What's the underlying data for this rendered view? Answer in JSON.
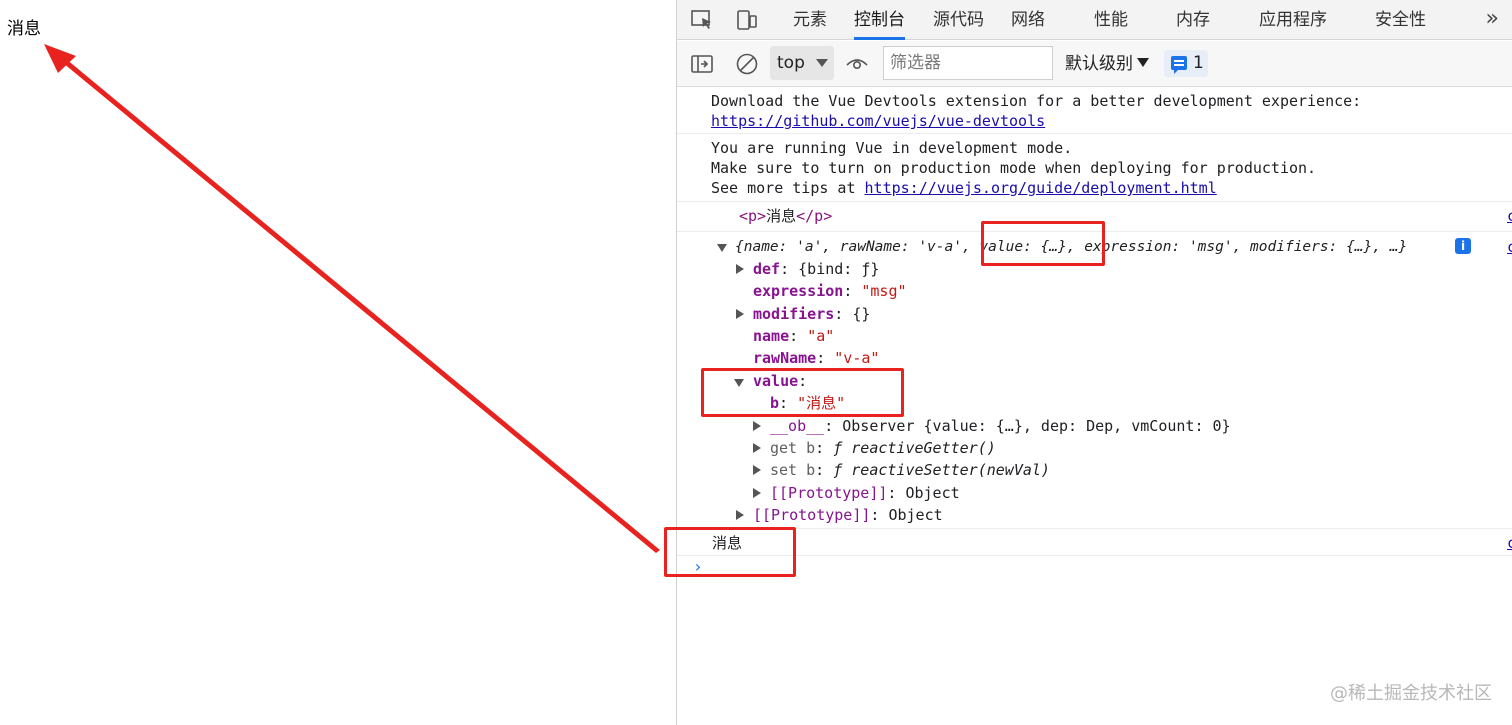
{
  "page": {
    "text": "消息"
  },
  "devtools": {
    "tabs": [
      "元素",
      "控制台",
      "源代码",
      "网络",
      "性能",
      "内存",
      "应用程序",
      "安全性"
    ],
    "active_tab": "控制台",
    "toolbar": {
      "context": "top",
      "filter_placeholder": "筛选器",
      "levels": "默认级别",
      "issues_count": "1"
    }
  },
  "console": {
    "msg1": {
      "text": "Download the Vue Devtools extension for a better development experience:",
      "link": "https://github.com/vuejs/vue-devtools"
    },
    "msg2": {
      "line1": "You are running Vue in development mode.",
      "line2": "Make sure to turn on production mode when deploying for production.",
      "line3_prefix": "See more tips at ",
      "link": "https://vuejs.org/guide/deployment.html"
    },
    "msg3": {
      "open": "<p>",
      "content": "消息",
      "close": "</p>"
    },
    "obj": {
      "summary": "{name: 'a', rawName: 'v-a', value: {…}, expression: 'msg', modifiers: {…}, …}",
      "def_key": "def",
      "def_val": "{bind: ƒ}",
      "expression_key": "expression",
      "expression_val": "\"msg\"",
      "modifiers_key": "modifiers",
      "modifiers_val": "{}",
      "name_key": "name",
      "name_val": "\"a\"",
      "rawName_key": "rawName",
      "rawName_val": "\"v-a\"",
      "value_key": "value",
      "b_key": "b",
      "b_val": "\"消息\"",
      "ob_key": "__ob__",
      "ob_val": "Observer {value: {…}, dep: Dep, vmCount: 0}",
      "getb_key": "get b",
      "getb_val": "ƒ reactiveGetter()",
      "setb_key": "set b",
      "setb_val": "ƒ reactiveSetter(newVal)",
      "proto_inner_key": "[[Prototype]]",
      "proto_inner_val": "Object",
      "proto_outer_key": "[[Prototype]]",
      "proto_outer_val": "Object"
    },
    "msg4": {
      "text": "消息"
    },
    "source_link": "c"
  },
  "watermark": "@稀土掘金技术社区",
  "colors": {
    "annotation": "#e8231f",
    "accent": "#1a73e8"
  }
}
